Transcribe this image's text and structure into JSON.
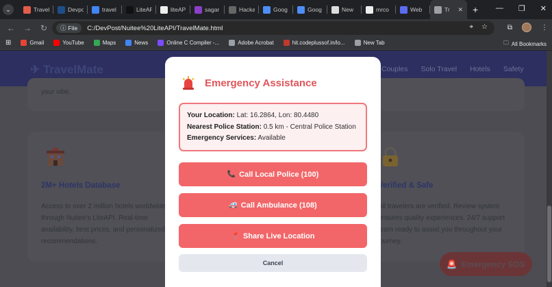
{
  "browser": {
    "tabs": [
      {
        "title": "Travel",
        "icon": "heart-icon",
        "color": "#e25c4a"
      },
      {
        "title": "Devpo",
        "icon": "devpost-icon",
        "color": "#1d4e89"
      },
      {
        "title": "travel",
        "icon": "google-icon",
        "color": "#4285f4"
      },
      {
        "title": "LiteAP",
        "icon": "notion-icon",
        "color": "#111111"
      },
      {
        "title": "liteAP",
        "icon": "liteapi-icon",
        "color": "#eeeeee"
      },
      {
        "title": "sagar",
        "icon": "sagar-icon",
        "color": "#8b3fc6"
      },
      {
        "title": "Hacka",
        "icon": "hackathon-icon",
        "color": "#666666"
      },
      {
        "title": "Goog",
        "icon": "gemini-icon",
        "color": "#4d8ef7"
      },
      {
        "title": "Goog",
        "icon": "gemini-icon",
        "color": "#4d8ef7"
      },
      {
        "title": "New",
        "icon": "chatgpt-icon",
        "color": "#dddddd"
      },
      {
        "title": "mrco",
        "icon": "github-icon",
        "color": "#eeeeee"
      },
      {
        "title": "Web",
        "icon": "web-icon",
        "color": "#5b6cf0"
      },
      {
        "title": "Tr",
        "icon": "globe-icon",
        "color": "#9aa0a6"
      }
    ],
    "address": {
      "chip": "File",
      "url": "C:/DevPost/Nuitee%20LiteAPI/TravelMate.html"
    },
    "bookmarks": [
      {
        "label": "Gmail",
        "icon": "gmail-icon",
        "color": "#ea4335"
      },
      {
        "label": "YouTube",
        "icon": "youtube-icon",
        "color": "#ff0000"
      },
      {
        "label": "Maps",
        "icon": "maps-icon",
        "color": "#34a853"
      },
      {
        "label": "News",
        "icon": "news-icon",
        "color": "#4285f4"
      },
      {
        "label": "Online C Compiler -...",
        "icon": "compiler-icon",
        "color": "#7b4cff"
      },
      {
        "label": "Adobe Acrobat",
        "icon": "globe-icon",
        "color": "#9aa0a6"
      },
      {
        "label": "hit.codeplussof.in/lo...",
        "icon": "codeplus-icon",
        "color": "#c0392b"
      },
      {
        "label": "New Tab",
        "icon": "globe-icon",
        "color": "#9aa0a6"
      }
    ],
    "all_bookmarks": "All Bookmarks"
  },
  "site": {
    "logo": "TravelMate",
    "nav": [
      "Couples",
      "Solo Travel",
      "Hotels",
      "Safety"
    ],
    "card_top_text": "your vibe.",
    "hotels": {
      "title": "2M+ Hotels Database",
      "lines": [
        "Access to over 2 million hotels worldwide",
        "through Nuitee's LiteAPI. Real-time",
        "availability, best prices, and personalized",
        "recommendations."
      ]
    },
    "safety": {
      "title": "Verified & Safe",
      "lines": [
        "All travelers are verified. Review system",
        "ensures quality experiences. 24/7 support",
        "team ready to assist you throughout your",
        "journey."
      ]
    },
    "sos_label": "Emergency SOS"
  },
  "modal": {
    "title": "Emergency Assistance",
    "location_label": "Your Location:",
    "location_value": "Lat: 16.2864, Lon: 80.4480",
    "police_label": "Nearest Police Station:",
    "police_value": "0.5 km - Central Police Station",
    "services_label": "Emergency Services:",
    "services_value": "Available",
    "call_police": "Call Local Police (100)",
    "call_ambulance": "Call Ambulance (108)",
    "share_location": "Share Live Location",
    "cancel": "Cancel"
  }
}
